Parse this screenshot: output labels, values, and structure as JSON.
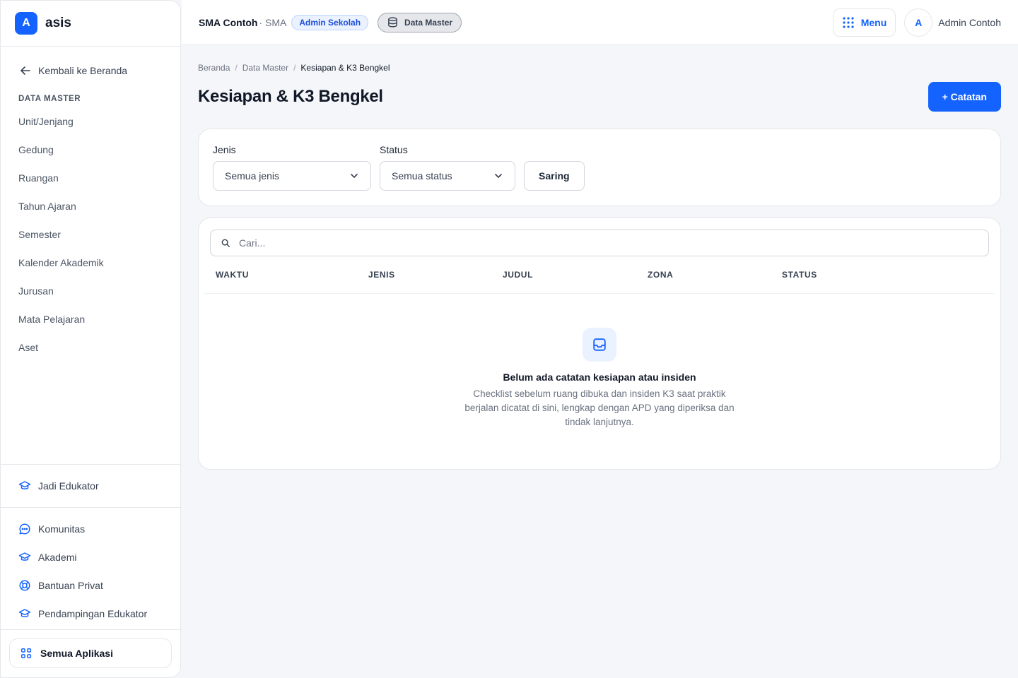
{
  "brand": {
    "logo_letter": "A",
    "name": "asis"
  },
  "sidebar": {
    "back_label": "Kembali ke Beranda",
    "section_title": "DATA MASTER",
    "items": [
      {
        "label": "Unit/Jenjang"
      },
      {
        "label": "Gedung"
      },
      {
        "label": "Ruangan"
      },
      {
        "label": "Tahun Ajaran"
      },
      {
        "label": "Semester"
      },
      {
        "label": "Kalender Akademik"
      },
      {
        "label": "Jurusan"
      },
      {
        "label": "Mata Pelajaran"
      },
      {
        "label": "Aset"
      }
    ],
    "educator_label": "Jadi Edukator",
    "links": [
      {
        "label": "Komunitas",
        "icon": "chat-bubble-icon"
      },
      {
        "label": "Akademi",
        "icon": "graduation-cap-icon"
      },
      {
        "label": "Bantuan Privat",
        "icon": "lifebuoy-icon"
      },
      {
        "label": "Pendampingan Edukator",
        "icon": "graduation-cap-icon"
      }
    ],
    "all_apps_label": "Semua Aplikasi"
  },
  "topbar": {
    "school_name": "SMA Contoh",
    "school_level": "· SMA",
    "role_badge": "Admin Sekolah",
    "module_label": "Data Master",
    "menu_label": "Menu",
    "avatar_letter": "A",
    "user_name": "Admin Contoh"
  },
  "breadcrumb": [
    "Beranda",
    "Data Master",
    "Kesiapan & K3 Bengkel"
  ],
  "page": {
    "title": "Kesiapan & K3 Bengkel",
    "add_button": "+ Catatan"
  },
  "filters": {
    "jenis_label": "Jenis",
    "jenis_value": "Semua jenis",
    "status_label": "Status",
    "status_value": "Semua status",
    "apply_label": "Saring"
  },
  "table": {
    "search_placeholder": "Cari...",
    "columns": [
      "WAKTU",
      "JENIS",
      "JUDUL",
      "ZONA",
      "STATUS"
    ],
    "rows": [],
    "empty_title": "Belum ada catatan kesiapan atau insiden",
    "empty_desc": "Checklist sebelum ruang dibuka dan insiden K3 saat praktik berjalan dicatat di sini, lengkap dengan APD yang diperiksa dan tindak lanjutnya."
  },
  "colors": {
    "accent": "#1463ff",
    "accent_soft": "#eaf1ff",
    "border": "#e5e7eb",
    "background": "#f4f6f9"
  }
}
